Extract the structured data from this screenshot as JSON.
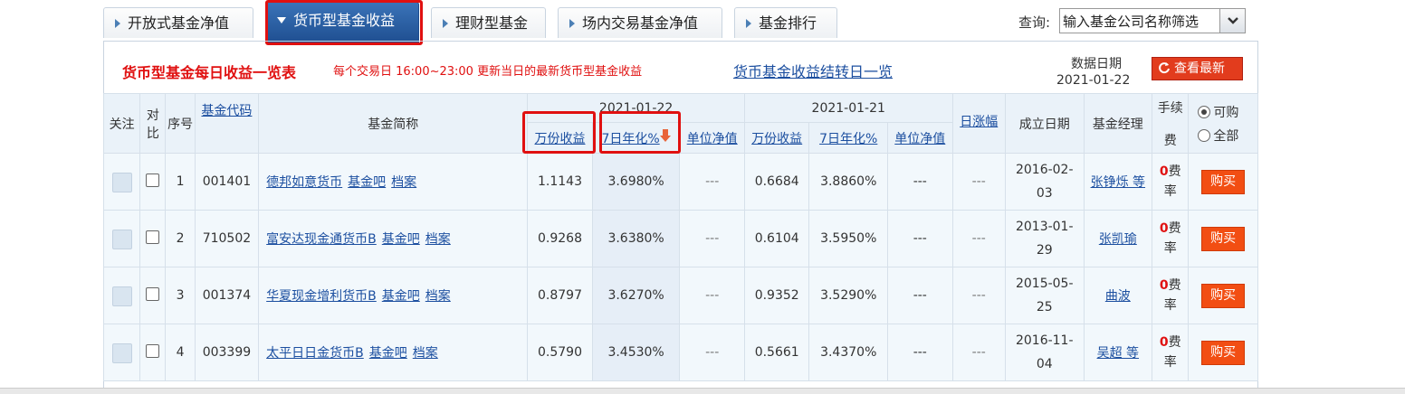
{
  "tabs": [
    {
      "label": "开放式基金净值"
    },
    {
      "label": "货币型基金收益"
    },
    {
      "label": "理财型基金"
    },
    {
      "label": "场内交易基金净值"
    },
    {
      "label": "基金排行"
    }
  ],
  "search": {
    "label": "查询:",
    "value": "输入基金公司名称筛选"
  },
  "header": {
    "title": "货币型基金每日收益一览表",
    "subtitle": "每个交易日 16:00~23:00 更新当日的最新货币型基金收益",
    "link": "货币基金收益结转日一览",
    "date_label": "数据日期",
    "date_value": "2021-01-22",
    "refresh_label": "查看最新"
  },
  "columns": {
    "follow": "关注",
    "compare1": "对",
    "compare2": "比",
    "index": "序号",
    "code": "基金代码",
    "name": "基金简称",
    "date1": "2021-01-22",
    "date2": "2021-01-21",
    "wan": "万份收益",
    "qiri": "7日年化%",
    "unit": "单位净值",
    "daily": "日涨幅",
    "founded": "成立日期",
    "manager": "基金经理",
    "fee1": "手续",
    "fee2": "费",
    "buyable": "可购",
    "all": "全部"
  },
  "rows": [
    {
      "index": "1",
      "code": "001401",
      "name": "德邦如意货币",
      "bar": "基金吧",
      "doc": "档案",
      "wan1": "1.1143",
      "qiri1": "3.6980%",
      "unit1": "---",
      "wan2": "0.6684",
      "qiri2": "3.8860%",
      "unit2": "---",
      "daily": "---",
      "date_a": "2016-02-",
      "date_b": "03",
      "manager": "张铮烁 等",
      "fee_a": "0",
      "fee_b": "费",
      "fee_c": "率",
      "buy": "购买"
    },
    {
      "index": "2",
      "code": "710502",
      "name": "富安达现金通货币B",
      "bar": "基金吧",
      "doc": "档案",
      "wan1": "0.9268",
      "qiri1": "3.6380%",
      "unit1": "---",
      "wan2": "0.6104",
      "qiri2": "3.5950%",
      "unit2": "---",
      "daily": "---",
      "date_a": "2013-01-",
      "date_b": "29",
      "manager": "张凯瑜",
      "fee_a": "0",
      "fee_b": "费",
      "fee_c": "率",
      "buy": "购买"
    },
    {
      "index": "3",
      "code": "001374",
      "name": "华夏现金增利货币B",
      "bar": "基金吧",
      "doc": "档案",
      "wan1": "0.8797",
      "qiri1": "3.6270%",
      "unit1": "---",
      "wan2": "0.9352",
      "qiri2": "3.5290%",
      "unit2": "---",
      "daily": "---",
      "date_a": "2015-05-",
      "date_b": "25",
      "manager": "曲波",
      "fee_a": "0",
      "fee_b": "费",
      "fee_c": "率",
      "buy": "购买"
    },
    {
      "index": "4",
      "code": "003399",
      "name": "太平日日金货币B",
      "bar": "基金吧",
      "doc": "档案",
      "wan1": "0.5790",
      "qiri1": "3.4530%",
      "unit1": "---",
      "wan2": "0.5661",
      "qiri2": "3.4370%",
      "unit2": "---",
      "daily": "---",
      "date_a": "2016-11-",
      "date_b": "04",
      "manager": "吴超 等",
      "fee_a": "0",
      "fee_b": "费",
      "fee_c": "率",
      "buy": "购买"
    }
  ]
}
